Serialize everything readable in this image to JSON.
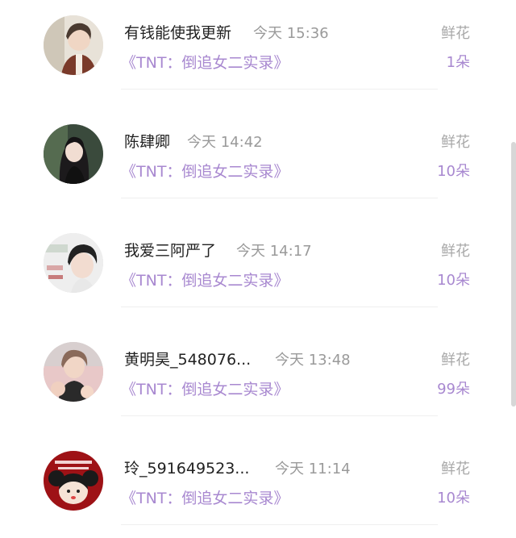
{
  "items": [
    {
      "name": "有钱能使我更新",
      "time": "今天 15:36",
      "book": "《TNT：倒追女二实录》",
      "gift_label": "鲜花",
      "gift_count": "1朵"
    },
    {
      "name": "陈肆卿",
      "time": "今天 14:42",
      "book": "《TNT：倒追女二实录》",
      "gift_label": "鲜花",
      "gift_count": "10朵"
    },
    {
      "name": "我爱三阿严了",
      "time": "今天 14:17",
      "book": "《TNT：倒追女二实录》",
      "gift_label": "鲜花",
      "gift_count": "10朵"
    },
    {
      "name": "黄明昊_548076...",
      "time": "今天 13:48",
      "book": "《TNT：倒追女二实录》",
      "gift_label": "鲜花",
      "gift_count": "99朵"
    },
    {
      "name": "玲_591649523...",
      "time": "今天 11:14",
      "book": "《TNT：倒追女二实录》",
      "gift_label": "鲜花",
      "gift_count": "10朵"
    }
  ]
}
